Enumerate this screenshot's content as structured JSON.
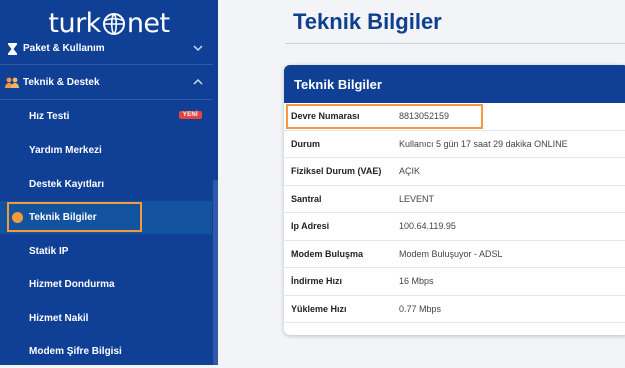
{
  "logo": {
    "text_left": "turk",
    "text_right": "net"
  },
  "sidebar": {
    "sections": [
      {
        "label": "Paket & Kullanım",
        "icon": "hourglass-icon",
        "expanded": false
      },
      {
        "label": "Teknik & Destek",
        "icon": "users-icon",
        "expanded": true
      }
    ],
    "items": [
      {
        "label": "Hız Testi",
        "badge": "YENİ"
      },
      {
        "label": "Yardım Merkezi"
      },
      {
        "label": "Destek Kayıtları"
      },
      {
        "label": "Teknik Bilgiler",
        "active": true
      },
      {
        "label": "Statik IP"
      },
      {
        "label": "Hizmet Dondurma"
      },
      {
        "label": "Hizmet Nakil"
      },
      {
        "label": "Modem Şifre Bilgisi"
      }
    ]
  },
  "page": {
    "title": "Teknik Bilgiler"
  },
  "card": {
    "title": "Teknik Bilgiler",
    "rows": [
      {
        "key": "Devre Numarası",
        "value": "8813052159"
      },
      {
        "key": "Durum",
        "value": "Kullanıcı 5 gün 17 saat 29 dakika ONLINE"
      },
      {
        "key": "Fiziksel Durum (VAE)",
        "value": "AÇIK"
      },
      {
        "key": "Santral",
        "value": "LEVENT"
      },
      {
        "key": "Ip Adresi",
        "value": "100.64.119.95"
      },
      {
        "key": "Modem Buluşma",
        "value": "Modem Buluşuyor - ADSL"
      },
      {
        "key": "İndirme Hızı",
        "value": "16 Mbps"
      },
      {
        "key": "Yükleme Hızı",
        "value": "0.77 Mbps"
      }
    ]
  },
  "colors": {
    "sidebar": "#0f4096",
    "accent": "#f39a3c",
    "title": "#0f3f8f",
    "badge": "#e2453f"
  }
}
